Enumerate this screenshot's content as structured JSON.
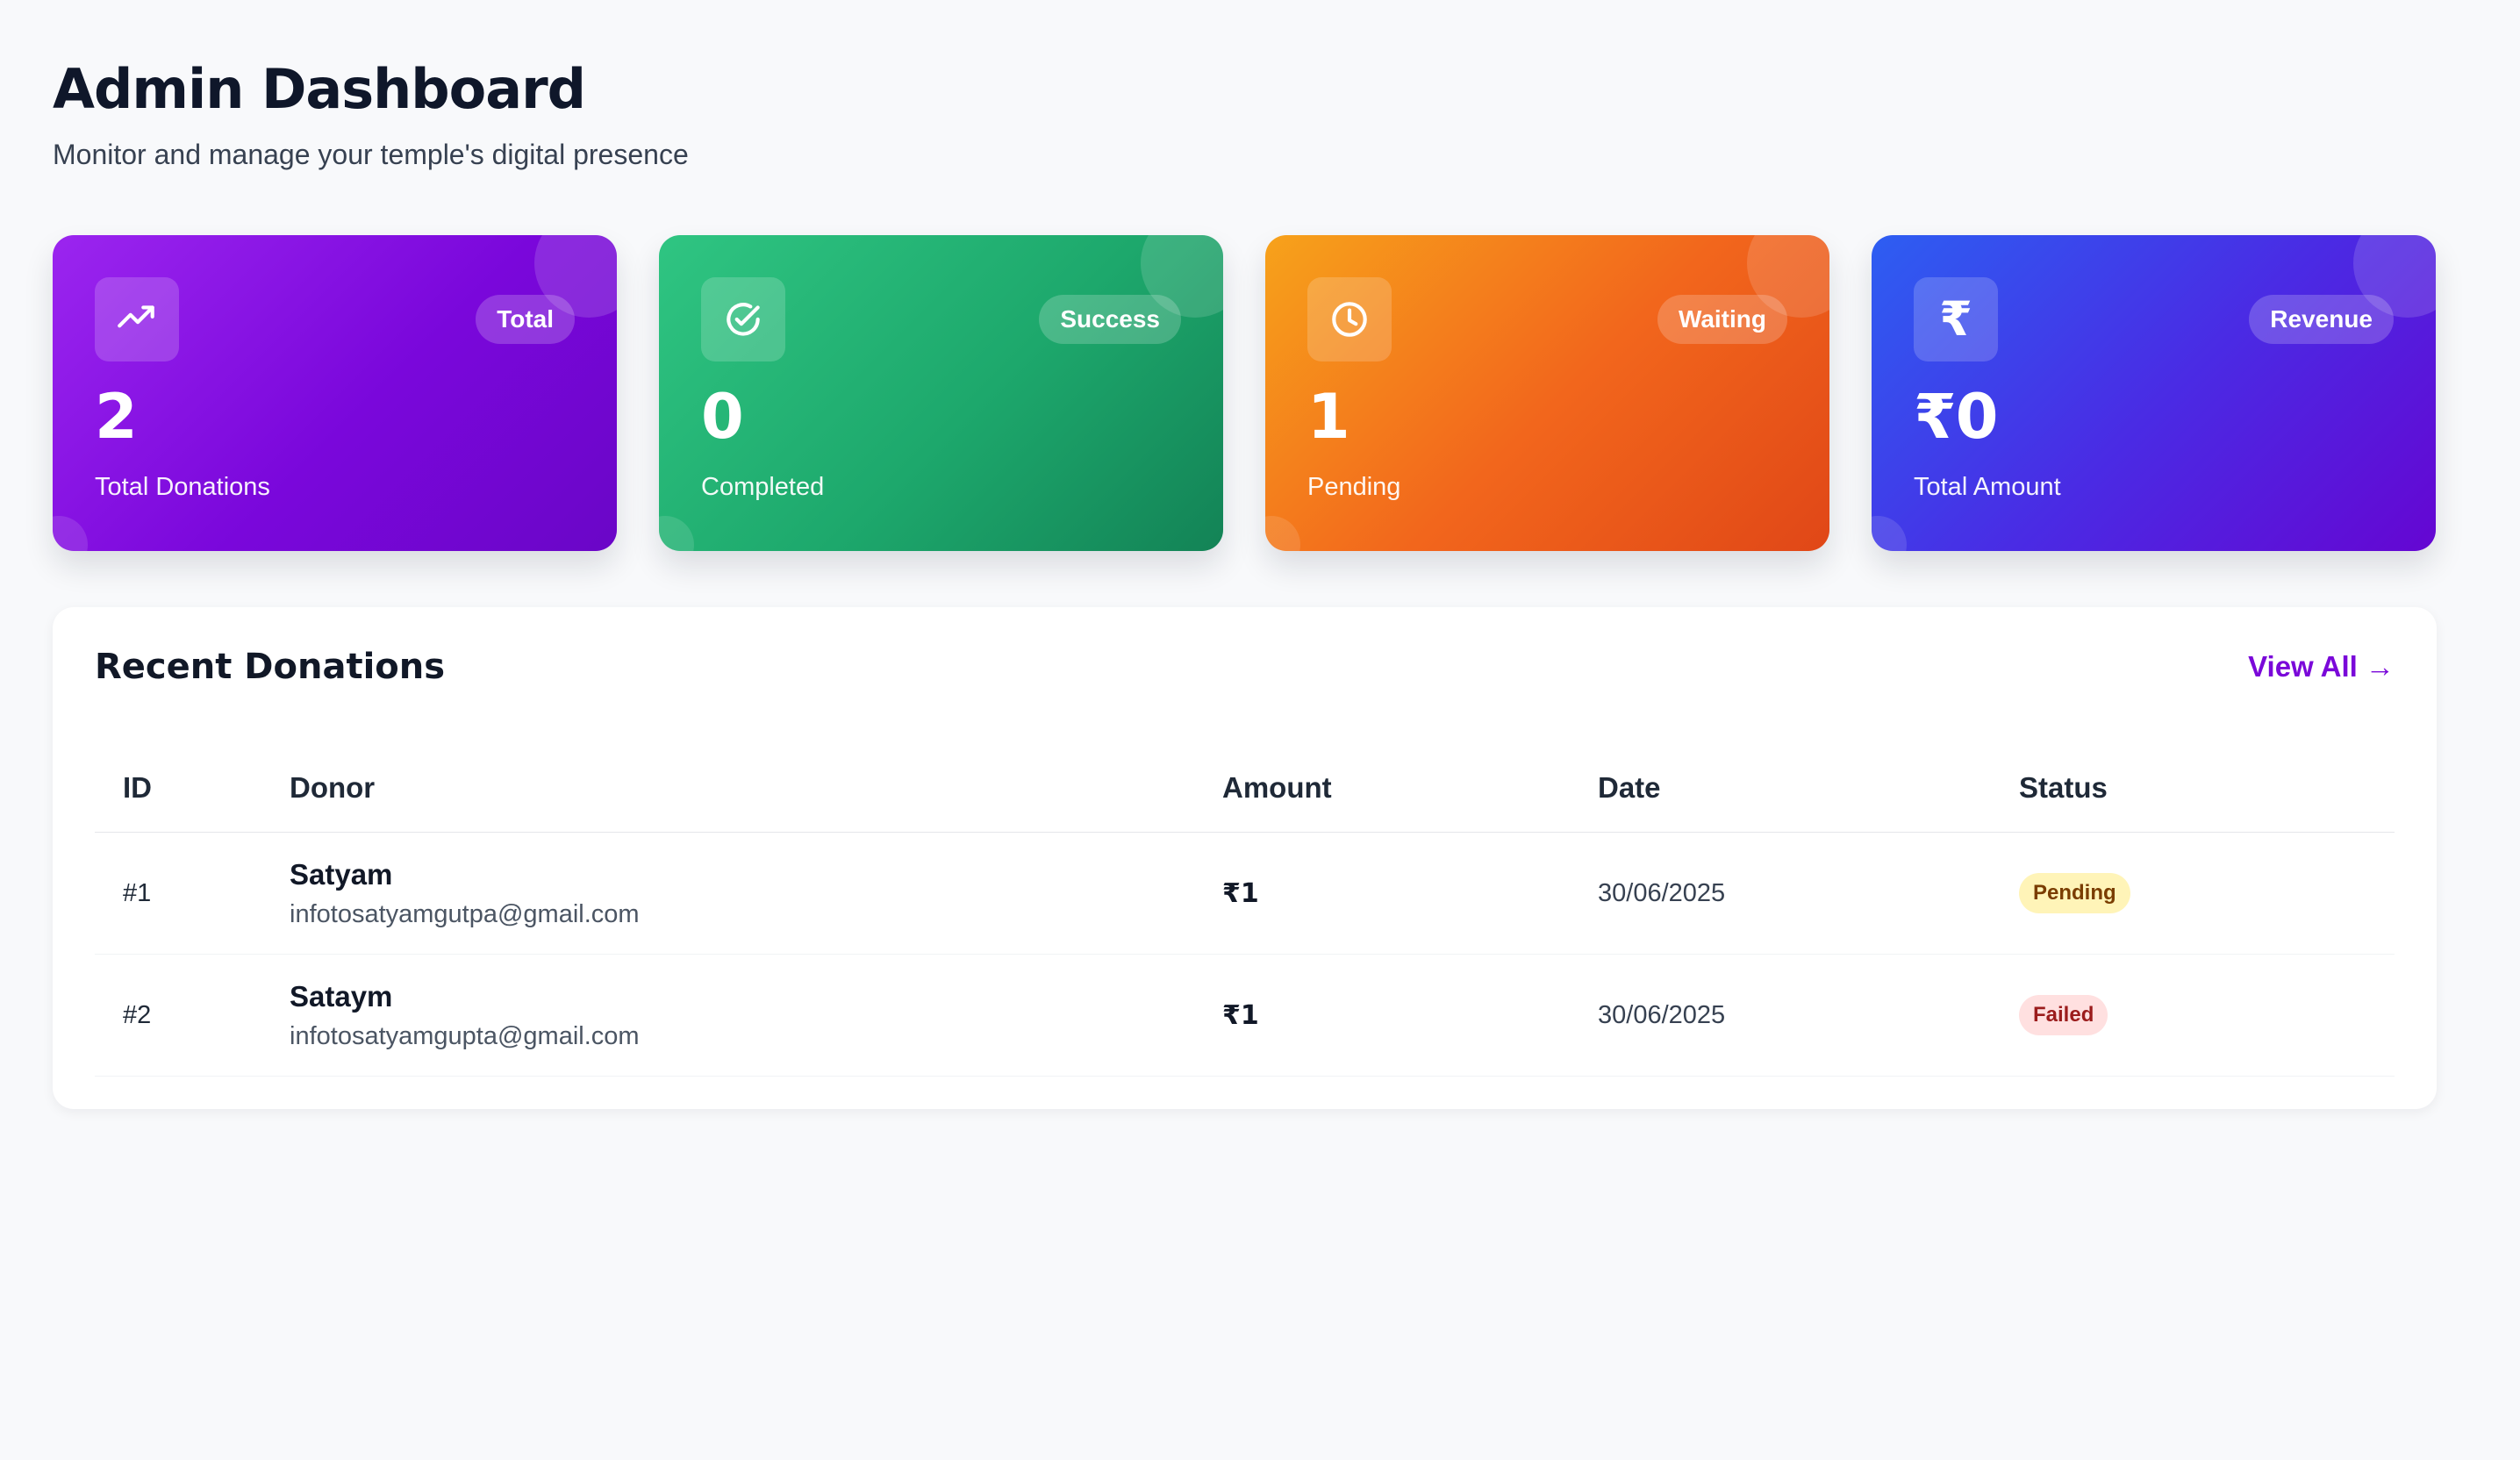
{
  "header": {
    "title": "Admin Dashboard",
    "subtitle": "Monitor and manage your temple's digital presence"
  },
  "stats": [
    {
      "icon": "trending-up-icon",
      "badge": "Total",
      "value": "2",
      "label": "Total Donations",
      "color": "#8b14e8"
    },
    {
      "icon": "check-circle-icon",
      "badge": "Success",
      "value": "0",
      "label": "Completed",
      "color": "#1fb26f"
    },
    {
      "icon": "clock-icon",
      "badge": "Waiting",
      "value": "1",
      "label": "Pending",
      "color": "#f26a1b"
    },
    {
      "icon": "rupee-icon",
      "badge": "Revenue",
      "value": "₹0",
      "label": "Total Amount",
      "color": "#4a2be4"
    }
  ],
  "recent_donations": {
    "title": "Recent Donations",
    "view_all_label": "View All →",
    "columns": [
      "ID",
      "Donor",
      "Amount",
      "Date",
      "Status"
    ],
    "rows": [
      {
        "id": "#1",
        "donor_name": "Satyam",
        "donor_email": "infotosatyamgutpa@gmail.com",
        "amount": "₹1",
        "date": "30/06/2025",
        "status": "Pending",
        "status_color": "#fff4b8"
      },
      {
        "id": "#2",
        "donor_name": "Sataym",
        "donor_email": "infotosatyamgupta@gmail.com",
        "amount": "₹1",
        "date": "30/06/2025",
        "status": "Failed",
        "status_color": "#ffe0e0"
      }
    ]
  }
}
